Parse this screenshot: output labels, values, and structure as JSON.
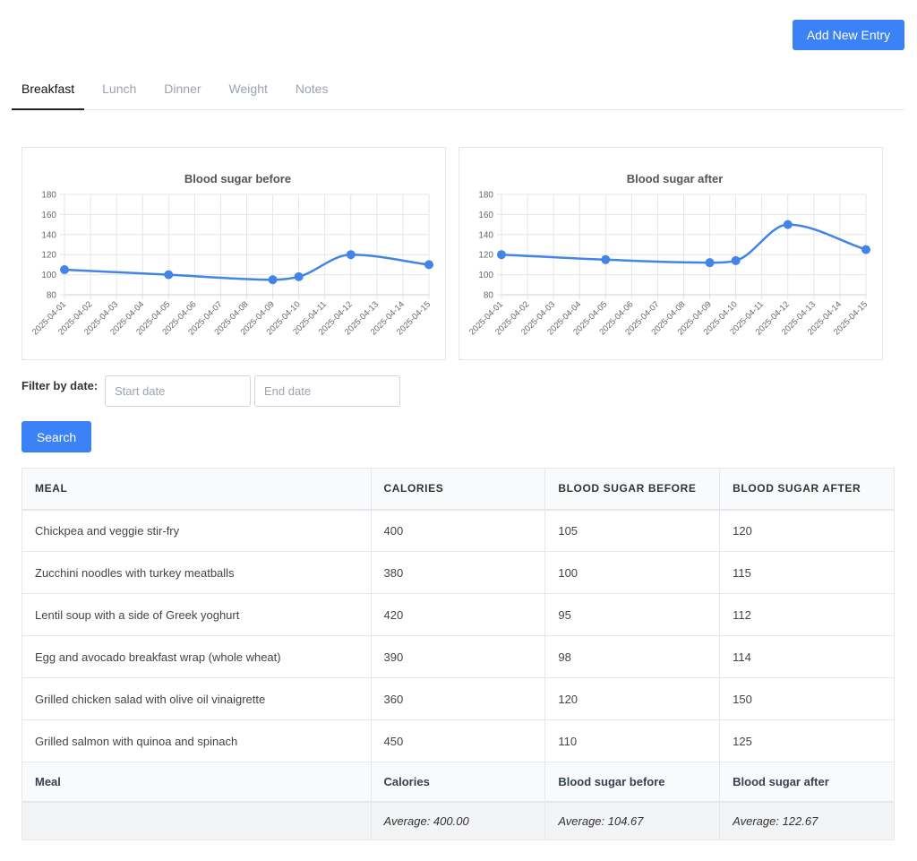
{
  "header": {
    "add_button_label": "Add New Entry"
  },
  "tabs": [
    {
      "label": "Breakfast",
      "active": true
    },
    {
      "label": "Lunch",
      "active": false
    },
    {
      "label": "Dinner",
      "active": false
    },
    {
      "label": "Weight",
      "active": false
    },
    {
      "label": "Notes",
      "active": false
    }
  ],
  "colors": {
    "accent": "#3b82f6",
    "line": "#4285e6"
  },
  "chart_data": [
    {
      "type": "line",
      "title": "Blood sugar before",
      "x": [
        "2025-04-01",
        "2025-04-02",
        "2025-04-03",
        "2025-04-04",
        "2025-04-05",
        "2025-04-06",
        "2025-04-07",
        "2025-04-08",
        "2025-04-09",
        "2025-04-10",
        "2025-04-11",
        "2025-04-12",
        "2025-04-13",
        "2025-04-14",
        "2025-04-15"
      ],
      "points": [
        {
          "x": "2025-04-01",
          "y": 105
        },
        {
          "x": "2025-04-05",
          "y": 100
        },
        {
          "x": "2025-04-09",
          "y": 95
        },
        {
          "x": "2025-04-10",
          "y": 98
        },
        {
          "x": "2025-04-12",
          "y": 120
        },
        {
          "x": "2025-04-15",
          "y": 110
        }
      ],
      "ylim": [
        80,
        180
      ],
      "yticks": [
        80,
        100,
        120,
        140,
        160,
        180
      ],
      "grid": true,
      "legend": "none"
    },
    {
      "type": "line",
      "title": "Blood sugar after",
      "x": [
        "2025-04-01",
        "2025-04-02",
        "2025-04-03",
        "2025-04-04",
        "2025-04-05",
        "2025-04-06",
        "2025-04-07",
        "2025-04-08",
        "2025-04-09",
        "2025-04-10",
        "2025-04-11",
        "2025-04-12",
        "2025-04-13",
        "2025-04-14",
        "2025-04-15"
      ],
      "points": [
        {
          "x": "2025-04-01",
          "y": 120
        },
        {
          "x": "2025-04-05",
          "y": 115
        },
        {
          "x": "2025-04-09",
          "y": 112
        },
        {
          "x": "2025-04-10",
          "y": 114
        },
        {
          "x": "2025-04-12",
          "y": 150
        },
        {
          "x": "2025-04-15",
          "y": 125
        }
      ],
      "ylim": [
        80,
        180
      ],
      "yticks": [
        80,
        100,
        120,
        140,
        160,
        180
      ],
      "grid": true,
      "legend": "none"
    }
  ],
  "filter": {
    "label": "Filter by date:",
    "start_placeholder": "Start date",
    "end_placeholder": "End date",
    "search_label": "Search"
  },
  "table": {
    "headers": [
      "Meal",
      "Calories",
      "Blood sugar before",
      "Blood sugar after"
    ],
    "rows": [
      [
        "Chickpea and veggie stir-fry",
        "400",
        "105",
        "120"
      ],
      [
        "Zucchini noodles with turkey meatballs",
        "380",
        "100",
        "115"
      ],
      [
        "Lentil soup with a side of Greek yoghurt",
        "420",
        "95",
        "112"
      ],
      [
        "Egg and avocado breakfast wrap (whole wheat)",
        "390",
        "98",
        "114"
      ],
      [
        "Grilled chicken salad with olive oil vinaigrette",
        "360",
        "120",
        "150"
      ],
      [
        "Grilled salmon with quinoa and spinach",
        "450",
        "110",
        "125"
      ]
    ],
    "footer_headers": [
      "Meal",
      "Calories",
      "Blood sugar before",
      "Blood sugar after"
    ],
    "averages": [
      "",
      "Average: 400.00",
      "Average: 104.67",
      "Average: 122.67"
    ]
  }
}
